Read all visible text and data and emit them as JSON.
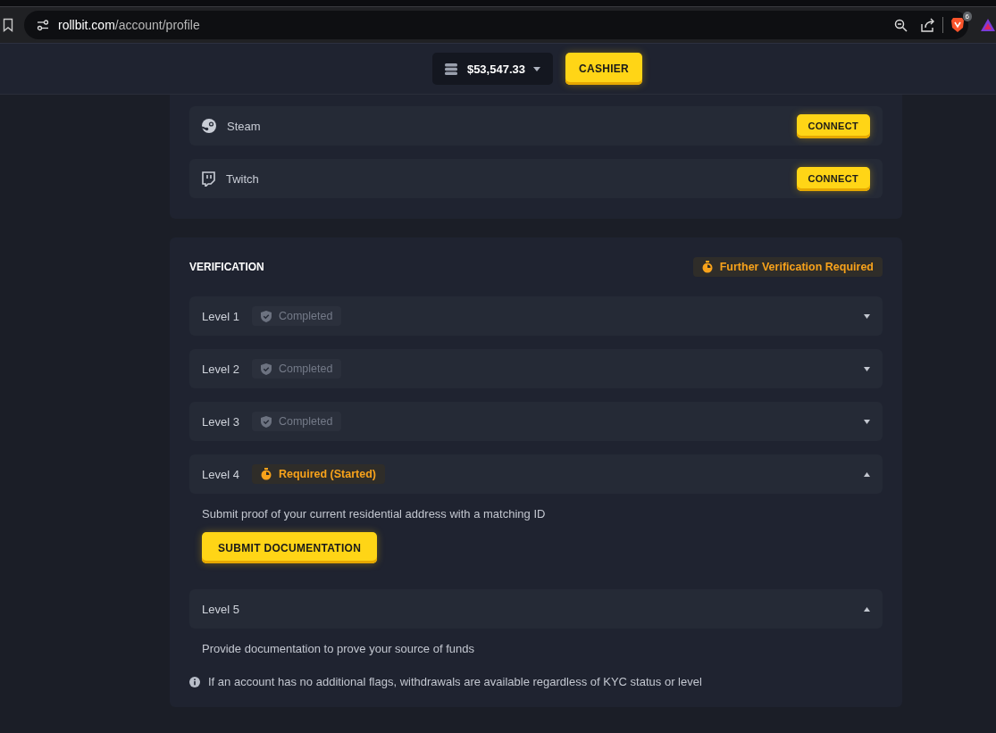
{
  "browser": {
    "url_host": "rollbit.com",
    "url_path": "/account/profile",
    "shields_count": "6"
  },
  "header": {
    "balance": "$53,547.33",
    "cashier_button": "CASHIER"
  },
  "connections": [
    {
      "kind": "steam",
      "name": "Steam",
      "button": "CONNECT"
    },
    {
      "kind": "twitch",
      "name": "Twitch",
      "button": "CONNECT"
    }
  ],
  "verification": {
    "title": "VERIFICATION",
    "status_badge": "Further Verification Required",
    "levels": [
      {
        "label": "Level 1",
        "kind": "completed",
        "badge": "Completed",
        "expanded": false
      },
      {
        "label": "Level 2",
        "kind": "completed",
        "badge": "Completed",
        "expanded": false
      },
      {
        "label": "Level 3",
        "kind": "completed",
        "badge": "Completed",
        "expanded": false
      },
      {
        "label": "Level 4",
        "kind": "required",
        "badge": "Required (Started)",
        "expanded": true,
        "description": "Submit proof of your current residential address with a matching ID",
        "button": "SUBMIT DOCUMENTATION"
      },
      {
        "label": "Level 5",
        "kind": "plain",
        "expanded": true,
        "description": "Provide documentation to prove your source of funds"
      }
    ],
    "note": "If an account has no additional flags, withdrawals are available regardless of KYC status or level"
  }
}
